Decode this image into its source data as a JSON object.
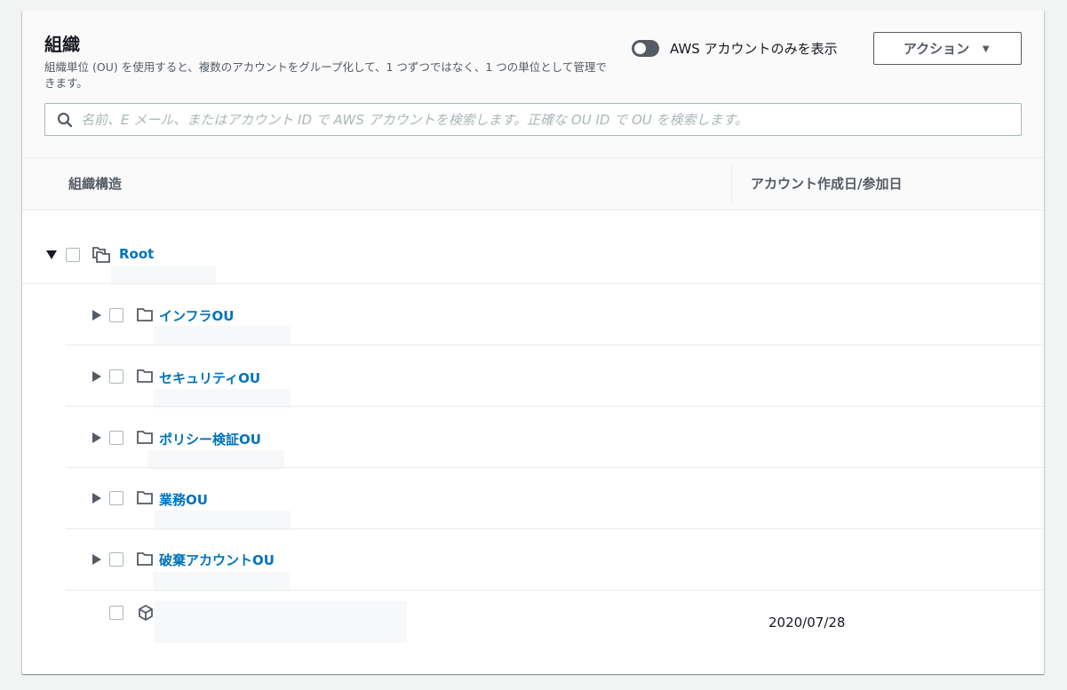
{
  "header": {
    "title": "組織",
    "description": "組織単位 (OU) を使用すると、複数のアカウントをグループ化して、1 つずつではなく、1 つの単位として管理できます。",
    "toggle_label": "AWS アカウントのみを表示",
    "toggle_on": false,
    "action_button": "アクション"
  },
  "search": {
    "placeholder": "名前、E メール、またはアカウント ID で AWS アカウントを検索します。正確な OU ID で OU を検索します。",
    "value": ""
  },
  "table": {
    "columns": [
      "組織構造",
      "アカウント作成日/参加日"
    ]
  },
  "tree": {
    "root": {
      "label": "Root",
      "expanded": true
    },
    "ous": [
      {
        "label": "インフラOU",
        "expanded": false
      },
      {
        "label": "セキュリティOU",
        "expanded": false
      },
      {
        "label": "ポリシー検証OU",
        "expanded": false
      },
      {
        "label": "業務OU",
        "expanded": false
      },
      {
        "label": "破棄アカウントOU",
        "expanded": false
      }
    ],
    "account": {
      "date": "2020/07/28"
    }
  },
  "icons": {
    "search": "search-icon",
    "root": "root-folders-icon",
    "ou": "folder-icon",
    "account": "account-cube-icon"
  },
  "colors": {
    "link": "#0073bb",
    "border": "#aab7b8",
    "header_bg": "#fafafa"
  }
}
